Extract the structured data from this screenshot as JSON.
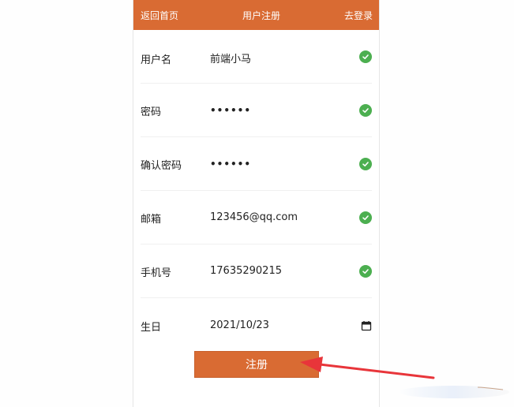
{
  "header": {
    "back_label": "返回首页",
    "title": "用户注册",
    "login_label": "去登录"
  },
  "fields": [
    {
      "label": "用户名",
      "value": "前端小马",
      "type": "text",
      "status": "check-icon"
    },
    {
      "label": "密码",
      "value": "••••••",
      "type": "password",
      "status": "check-icon"
    },
    {
      "label": "确认密码",
      "value": "••••••",
      "type": "password",
      "status": "check-icon"
    },
    {
      "label": "邮箱",
      "value": "123456@qq.com",
      "type": "text",
      "status": "check-icon"
    },
    {
      "label": "手机号",
      "value": "17635290215",
      "type": "text",
      "status": "check-icon"
    },
    {
      "label": "生日",
      "value": "2021/10/23",
      "type": "date",
      "status": "calendar-icon"
    }
  ],
  "submit_label": "注册",
  "colors": {
    "accent": "#d96b33",
    "success": "#4caf50",
    "annotation_arrow": "#e8353a"
  }
}
